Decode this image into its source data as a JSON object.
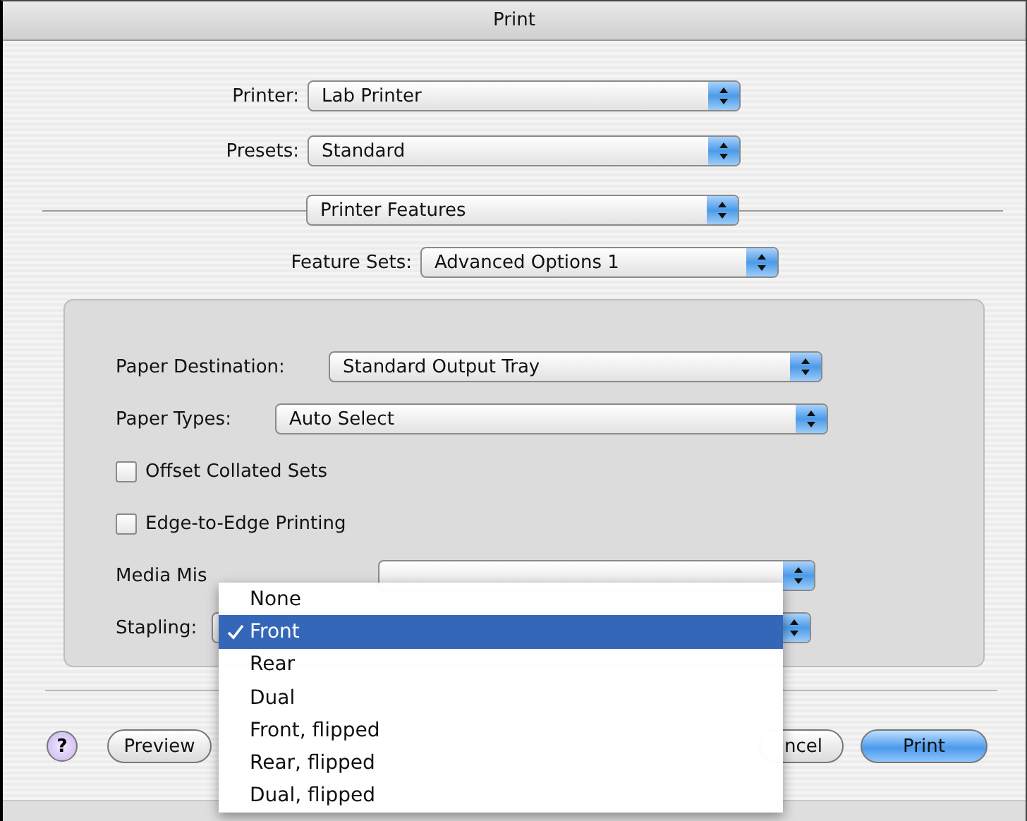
{
  "window": {
    "title": "Print"
  },
  "printer": {
    "label": "Printer:",
    "value": "Lab Printer"
  },
  "presets": {
    "label": "Presets:",
    "value": "Standard"
  },
  "panel_menu": {
    "value": "Printer Features"
  },
  "feature_sets": {
    "label": "Feature Sets:",
    "value": "Advanced Options 1"
  },
  "options": [
    {
      "kind": "popup",
      "label": "Paper Destination:",
      "value": "Standard Output Tray"
    },
    {
      "kind": "popup",
      "label": "Paper Types:",
      "value": "Auto Select"
    },
    {
      "kind": "checkbox",
      "label": "Offset Collated Sets",
      "checked": false
    },
    {
      "kind": "checkbox",
      "label": "Edge-to-Edge Printing",
      "checked": false
    },
    {
      "kind": "popup",
      "label": "Media Mis"
    },
    {
      "kind": "popup",
      "label": "Stapling:"
    }
  ],
  "stapling_menu": [
    {
      "label": "None",
      "selected": false
    },
    {
      "label": "Front",
      "selected": true
    },
    {
      "label": "Rear",
      "selected": false
    },
    {
      "label": "Dual",
      "selected": false
    },
    {
      "label": "Front, flipped",
      "selected": false
    },
    {
      "label": "Rear, flipped",
      "selected": false
    },
    {
      "label": "Dual, flipped",
      "selected": false
    }
  ],
  "help": {
    "label": "?"
  },
  "buttons": [
    {
      "label": "Preview",
      "default": false
    },
    {
      "label": "ncel",
      "default": false
    },
    {
      "label": "Print",
      "default": true
    }
  ]
}
